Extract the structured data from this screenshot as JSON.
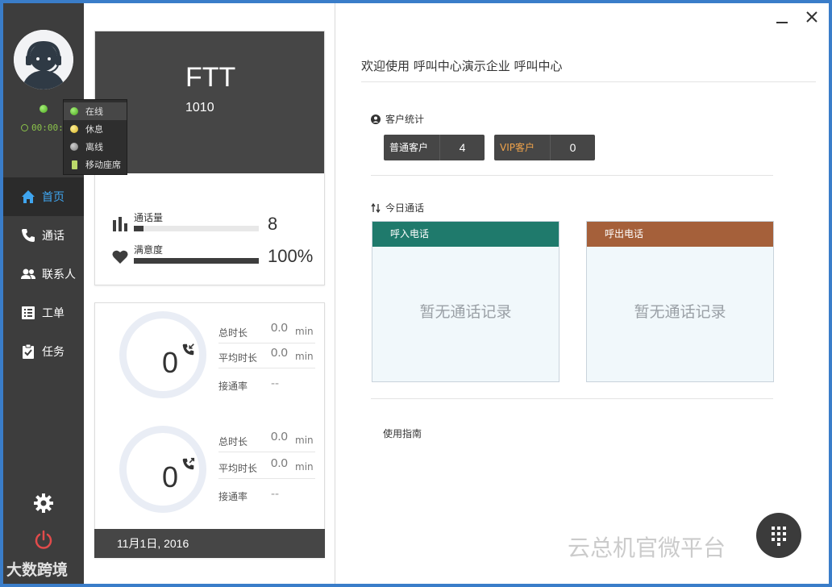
{
  "sidebar": {
    "timer": "00:00:",
    "status_menu": [
      {
        "label": "在线",
        "dot": "green",
        "active": true
      },
      {
        "label": "休息",
        "dot": "yellow",
        "active": false
      },
      {
        "label": "离线",
        "dot": "gray",
        "active": false
      },
      {
        "label": "移动座席",
        "dot": "phone",
        "active": false
      }
    ],
    "nav": [
      {
        "label": "首页",
        "icon": "home-icon",
        "active": true
      },
      {
        "label": "通话",
        "icon": "phone-icon",
        "active": false
      },
      {
        "label": "联系人",
        "icon": "contacts-icon",
        "active": false
      },
      {
        "label": "工单",
        "icon": "list-icon",
        "active": false
      },
      {
        "label": "任务",
        "icon": "task-icon",
        "active": false
      }
    ]
  },
  "profile": {
    "name": "FTT",
    "id": "1010",
    "call_volume_label": "通话量",
    "call_volume_value": "8",
    "call_volume_fill": 0.08,
    "satisfaction_label": "满意度",
    "satisfaction_value": "100%",
    "satisfaction_fill": 1.0
  },
  "calls": {
    "inbound": {
      "count": "0",
      "total_label": "总时长",
      "total_value": "0.0",
      "total_unit": "min",
      "avg_label": "平均时长",
      "avg_value": "0.0",
      "avg_unit": "min",
      "rate_label": "接通率",
      "rate_value": "--"
    },
    "outbound": {
      "count": "0",
      "total_label": "总时长",
      "total_value": "0.0",
      "total_unit": "min",
      "avg_label": "平均时长",
      "avg_value": "0.0",
      "avg_unit": "min",
      "rate_label": "接通率",
      "rate_value": "--"
    },
    "date": "11月1日, 2016"
  },
  "main": {
    "welcome": "欢迎使用 呼叫中心演示企业 呼叫中心",
    "customer_stats_title": "客户统计",
    "regular_label": "普通客户",
    "regular_value": "4",
    "vip_label": "VIP客户",
    "vip_value": "0",
    "today_calls_title": "今日通话",
    "inbound_title": "呼入电话",
    "inbound_empty": "暂无通话记录",
    "outbound_title": "呼出电话",
    "outbound_empty": "暂无通话记录",
    "guide": "使用指南"
  },
  "colors": {
    "inbound_header": "#1f7a6c",
    "outbound_header": "#a5603a",
    "accent": "#3fa5ef",
    "vip": "#f0a34a"
  },
  "watermarks": {
    "right": "云总机官微平台",
    "left": "大数跨境"
  }
}
